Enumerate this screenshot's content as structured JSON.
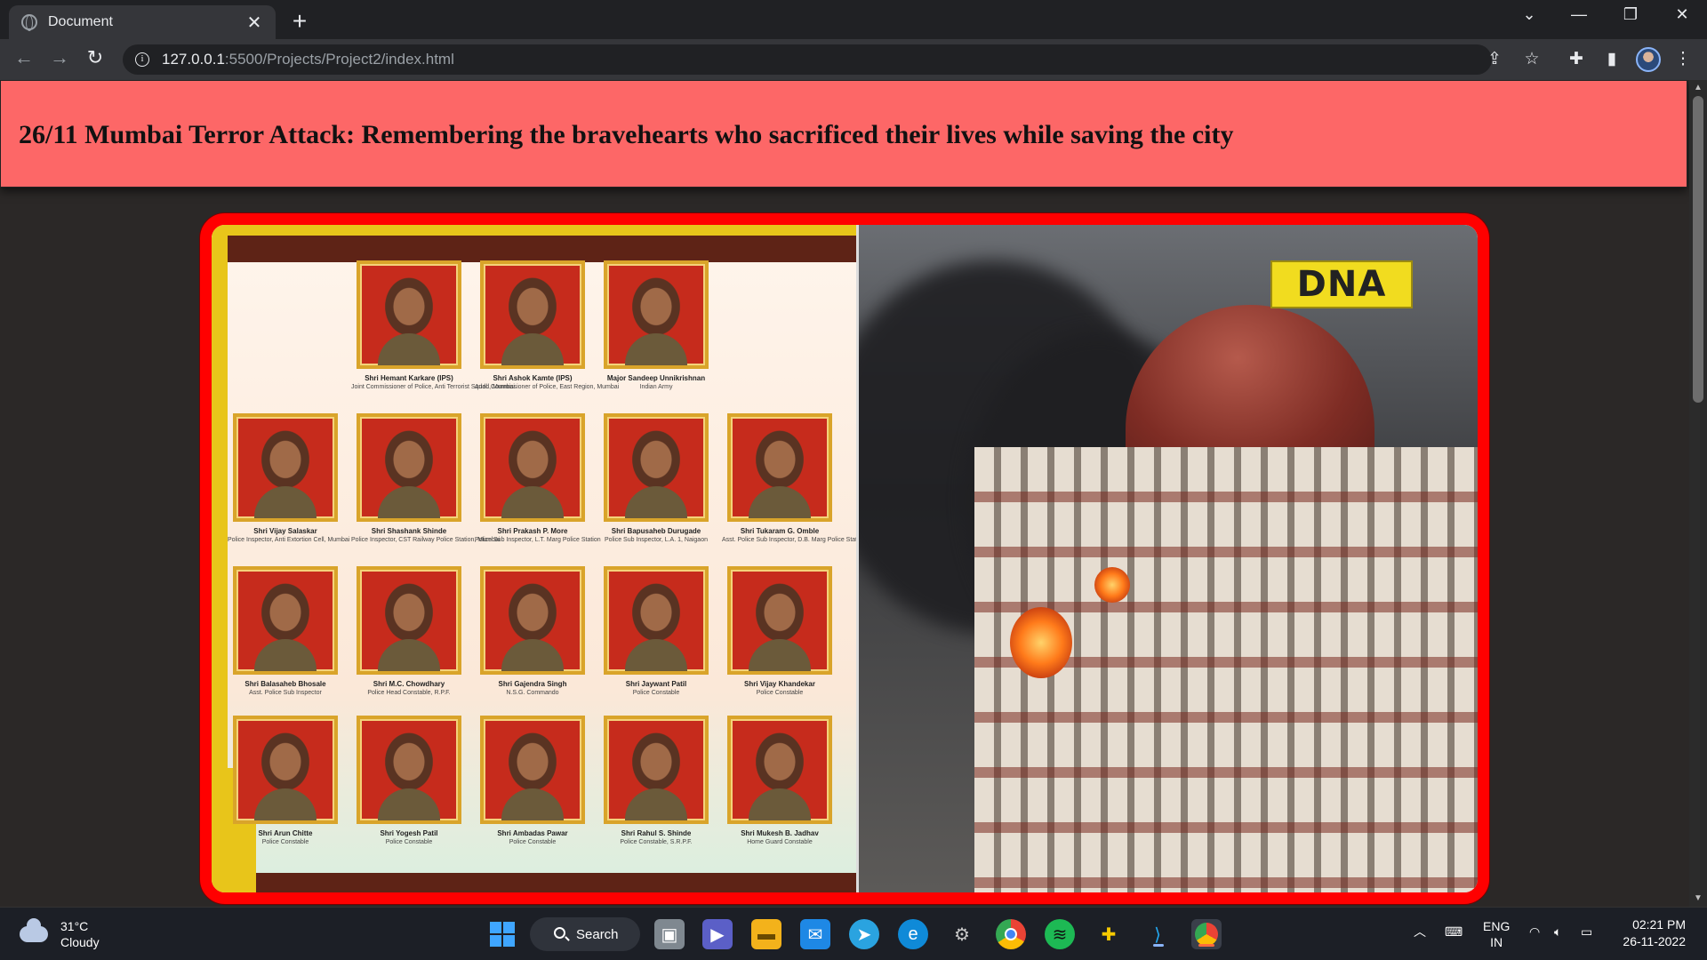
{
  "browser": {
    "tab_title": "Document",
    "tab_close": "✕",
    "new_tab": "+",
    "url_host": "127.0.0.1",
    "url_path": ":5500/Projects/Project2/index.html",
    "window_controls": [
      "⌄",
      "—",
      "❐",
      "✕"
    ]
  },
  "page": {
    "heading": "26/11 Mumbai Terror Attack: Remembering the bravehearts who sacrificed their lives while saving the city",
    "image": {
      "badge": "DNA",
      "heroes": [
        {
          "name": "Shri Hemant Karkare (IPS)",
          "role": "Joint Commissioner of Police, Anti Terrorist Squad, Mumbai"
        },
        {
          "name": "Shri Ashok Kamte (IPS)",
          "role": "Addl. Commissioner of Police, East Region, Mumbai"
        },
        {
          "name": "Major Sandeep Unnikrishnan",
          "role": "Indian Army"
        },
        {
          "name": "Shri Vijay Salaskar",
          "role": "Police Inspector, Anti Extortion Cell, Mumbai"
        },
        {
          "name": "Shri Shashank Shinde",
          "role": "Police Inspector, CST Railway Police Station, Mumbai"
        },
        {
          "name": "Shri Prakash P. More",
          "role": "Police Sub Inspector, L.T. Marg Police Station"
        },
        {
          "name": "Shri Bapusaheb Durugade",
          "role": "Police Sub Inspector, L.A. 1, Naigaon"
        },
        {
          "name": "Shri Tukaram G. Omble",
          "role": "Asst. Police Sub Inspector, D.B. Marg Police Station"
        },
        {
          "name": "Shri Balasaheb Bhosale",
          "role": "Asst. Police Sub Inspector"
        },
        {
          "name": "Shri M.C. Chowdhary",
          "role": "Police Head Constable, R.P.F."
        },
        {
          "name": "Shri Gajendra Singh",
          "role": "N.S.G. Commando"
        },
        {
          "name": "Shri Jaywant Patil",
          "role": "Police Constable"
        },
        {
          "name": "Shri Vijay Khandekar",
          "role": "Police Constable"
        },
        {
          "name": "Shri Arun Chitte",
          "role": "Police Constable"
        },
        {
          "name": "Shri Yogesh Patil",
          "role": "Police Constable"
        },
        {
          "name": "Shri Ambadas Pawar",
          "role": "Police Constable"
        },
        {
          "name": "Shri Rahul S. Shinde",
          "role": "Police Constable, S.R.P.F."
        },
        {
          "name": "Shri Mukesh B. Jadhav",
          "role": "Home Guard Constable"
        }
      ]
    }
  },
  "taskbar": {
    "weather_temp": "31°C",
    "weather_desc": "Cloudy",
    "search_label": "Search",
    "lang_line1": "ENG",
    "lang_line2": "IN",
    "time": "02:21 PM",
    "date": "26-11-2022"
  },
  "colors": {
    "header_bg": "#fd6767",
    "frame_border": "#ff0000",
    "page_bg": "#2b2827"
  }
}
